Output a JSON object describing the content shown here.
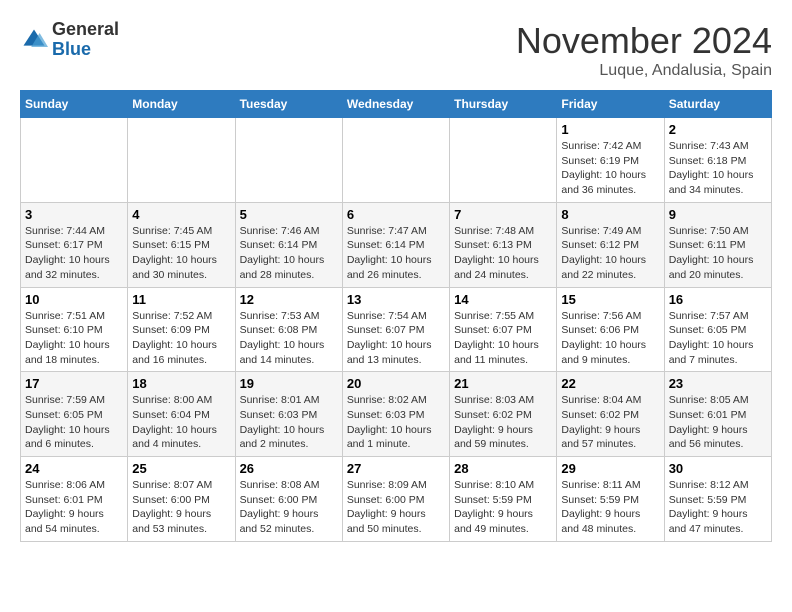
{
  "header": {
    "logo_general": "General",
    "logo_blue": "Blue",
    "month_title": "November 2024",
    "location": "Luque, Andalusia, Spain"
  },
  "weekdays": [
    "Sunday",
    "Monday",
    "Tuesday",
    "Wednesday",
    "Thursday",
    "Friday",
    "Saturday"
  ],
  "weeks": [
    [
      {
        "day": "",
        "info": ""
      },
      {
        "day": "",
        "info": ""
      },
      {
        "day": "",
        "info": ""
      },
      {
        "day": "",
        "info": ""
      },
      {
        "day": "",
        "info": ""
      },
      {
        "day": "1",
        "info": "Sunrise: 7:42 AM\nSunset: 6:19 PM\nDaylight: 10 hours and 36 minutes."
      },
      {
        "day": "2",
        "info": "Sunrise: 7:43 AM\nSunset: 6:18 PM\nDaylight: 10 hours and 34 minutes."
      }
    ],
    [
      {
        "day": "3",
        "info": "Sunrise: 7:44 AM\nSunset: 6:17 PM\nDaylight: 10 hours and 32 minutes."
      },
      {
        "day": "4",
        "info": "Sunrise: 7:45 AM\nSunset: 6:15 PM\nDaylight: 10 hours and 30 minutes."
      },
      {
        "day": "5",
        "info": "Sunrise: 7:46 AM\nSunset: 6:14 PM\nDaylight: 10 hours and 28 minutes."
      },
      {
        "day": "6",
        "info": "Sunrise: 7:47 AM\nSunset: 6:14 PM\nDaylight: 10 hours and 26 minutes."
      },
      {
        "day": "7",
        "info": "Sunrise: 7:48 AM\nSunset: 6:13 PM\nDaylight: 10 hours and 24 minutes."
      },
      {
        "day": "8",
        "info": "Sunrise: 7:49 AM\nSunset: 6:12 PM\nDaylight: 10 hours and 22 minutes."
      },
      {
        "day": "9",
        "info": "Sunrise: 7:50 AM\nSunset: 6:11 PM\nDaylight: 10 hours and 20 minutes."
      }
    ],
    [
      {
        "day": "10",
        "info": "Sunrise: 7:51 AM\nSunset: 6:10 PM\nDaylight: 10 hours and 18 minutes."
      },
      {
        "day": "11",
        "info": "Sunrise: 7:52 AM\nSunset: 6:09 PM\nDaylight: 10 hours and 16 minutes."
      },
      {
        "day": "12",
        "info": "Sunrise: 7:53 AM\nSunset: 6:08 PM\nDaylight: 10 hours and 14 minutes."
      },
      {
        "day": "13",
        "info": "Sunrise: 7:54 AM\nSunset: 6:07 PM\nDaylight: 10 hours and 13 minutes."
      },
      {
        "day": "14",
        "info": "Sunrise: 7:55 AM\nSunset: 6:07 PM\nDaylight: 10 hours and 11 minutes."
      },
      {
        "day": "15",
        "info": "Sunrise: 7:56 AM\nSunset: 6:06 PM\nDaylight: 10 hours and 9 minutes."
      },
      {
        "day": "16",
        "info": "Sunrise: 7:57 AM\nSunset: 6:05 PM\nDaylight: 10 hours and 7 minutes."
      }
    ],
    [
      {
        "day": "17",
        "info": "Sunrise: 7:59 AM\nSunset: 6:05 PM\nDaylight: 10 hours and 6 minutes."
      },
      {
        "day": "18",
        "info": "Sunrise: 8:00 AM\nSunset: 6:04 PM\nDaylight: 10 hours and 4 minutes."
      },
      {
        "day": "19",
        "info": "Sunrise: 8:01 AM\nSunset: 6:03 PM\nDaylight: 10 hours and 2 minutes."
      },
      {
        "day": "20",
        "info": "Sunrise: 8:02 AM\nSunset: 6:03 PM\nDaylight: 10 hours and 1 minute."
      },
      {
        "day": "21",
        "info": "Sunrise: 8:03 AM\nSunset: 6:02 PM\nDaylight: 9 hours and 59 minutes."
      },
      {
        "day": "22",
        "info": "Sunrise: 8:04 AM\nSunset: 6:02 PM\nDaylight: 9 hours and 57 minutes."
      },
      {
        "day": "23",
        "info": "Sunrise: 8:05 AM\nSunset: 6:01 PM\nDaylight: 9 hours and 56 minutes."
      }
    ],
    [
      {
        "day": "24",
        "info": "Sunrise: 8:06 AM\nSunset: 6:01 PM\nDaylight: 9 hours and 54 minutes."
      },
      {
        "day": "25",
        "info": "Sunrise: 8:07 AM\nSunset: 6:00 PM\nDaylight: 9 hours and 53 minutes."
      },
      {
        "day": "26",
        "info": "Sunrise: 8:08 AM\nSunset: 6:00 PM\nDaylight: 9 hours and 52 minutes."
      },
      {
        "day": "27",
        "info": "Sunrise: 8:09 AM\nSunset: 6:00 PM\nDaylight: 9 hours and 50 minutes."
      },
      {
        "day": "28",
        "info": "Sunrise: 8:10 AM\nSunset: 5:59 PM\nDaylight: 9 hours and 49 minutes."
      },
      {
        "day": "29",
        "info": "Sunrise: 8:11 AM\nSunset: 5:59 PM\nDaylight: 9 hours and 48 minutes."
      },
      {
        "day": "30",
        "info": "Sunrise: 8:12 AM\nSunset: 5:59 PM\nDaylight: 9 hours and 47 minutes."
      }
    ]
  ]
}
